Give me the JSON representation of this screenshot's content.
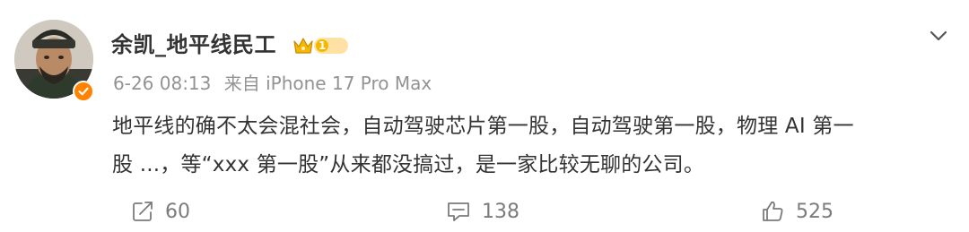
{
  "post": {
    "author": {
      "name": "余凯_地平线民工",
      "vip_level": "1"
    },
    "meta": {
      "time": "6-26 08:13",
      "source": "来自 iPhone 17 Pro Max"
    },
    "content": {
      "line1": "地平线的确不太会混社会，自动驾驶芯片第一股，自动驾驶第一股，物理 AI 第一",
      "line2": "股 ...，等“xxx 第一股”从来都没搞过，是一家比较无聊的公司。"
    },
    "actions": {
      "repost_count": "60",
      "comment_count": "138",
      "like_count": "525"
    }
  },
  "colors": {
    "verified": "#ff8200",
    "vip_gold": "#f5b800",
    "meta_gray": "#939393",
    "text": "#333333"
  },
  "icons": {
    "dropdown": "chevron-down-icon",
    "repost": "repost-icon",
    "comment": "comment-icon",
    "like": "like-icon",
    "verified": "verified-badge-icon",
    "vip": "crown-icon"
  }
}
